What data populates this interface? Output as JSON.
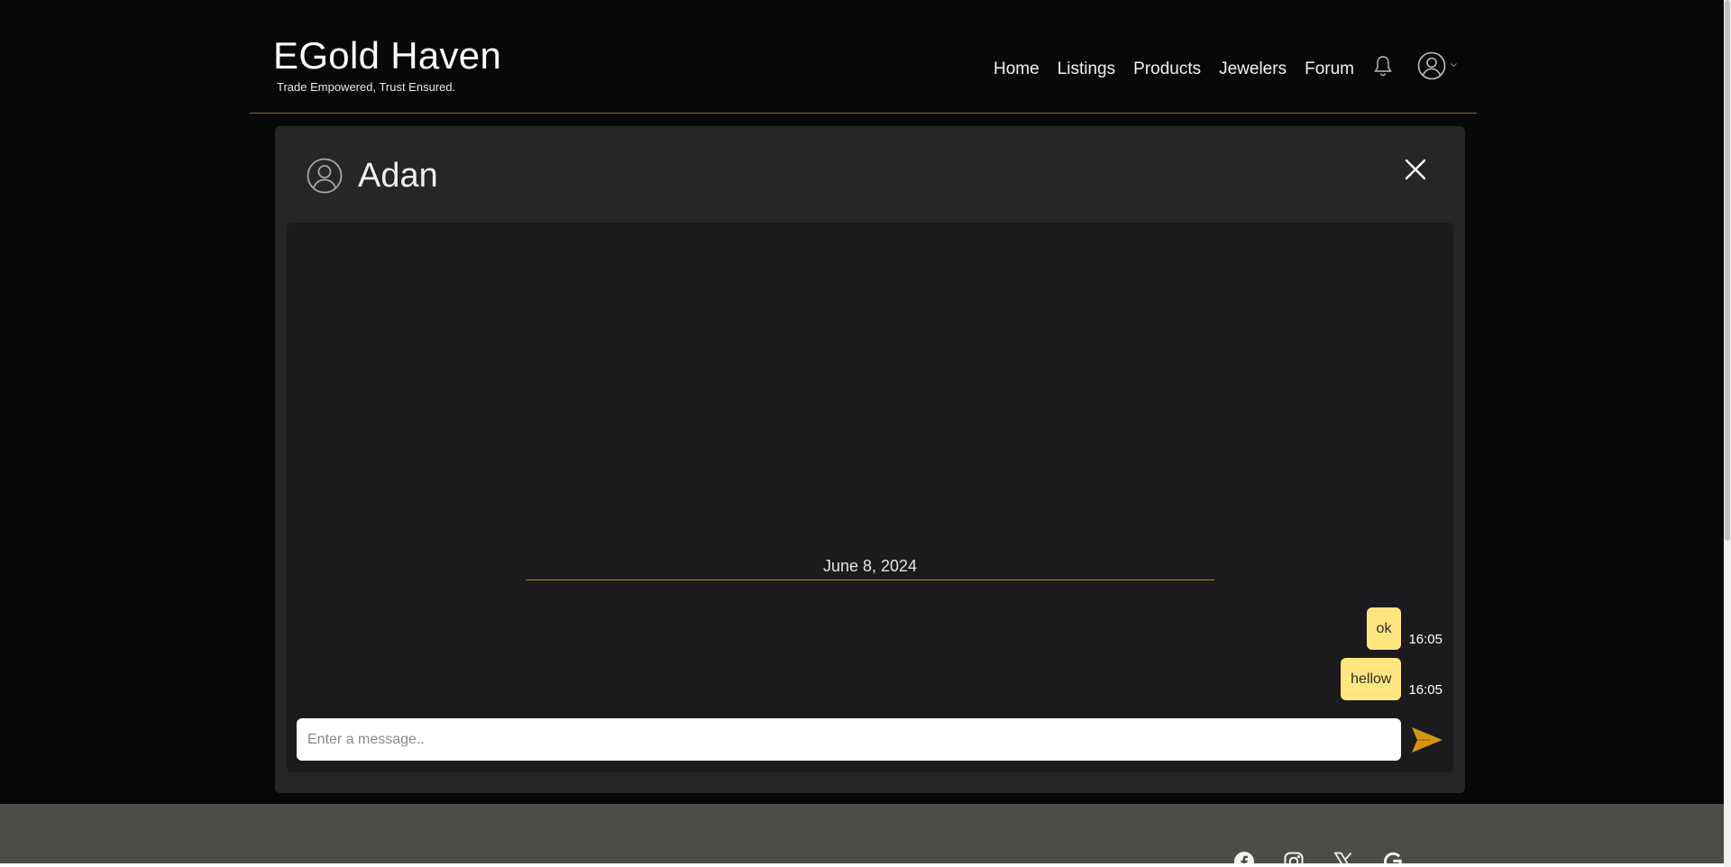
{
  "header": {
    "brand_title": "EGold Haven",
    "brand_tagline": "Trade Empowered, Trust Ensured.",
    "nav": [
      "Home",
      "Listings",
      "Products",
      "Jewelers",
      "Forum"
    ],
    "icons": [
      "bell-icon",
      "account-icon",
      "chevron-down-icon"
    ]
  },
  "chat": {
    "user_name": "Adan",
    "date_label": "June 8, 2024",
    "messages": [
      {
        "text": "ok",
        "time": "16:05"
      },
      {
        "text": "hellow",
        "time": "16:05"
      }
    ],
    "input_placeholder": "Enter a message..",
    "icons": [
      "user-circle-icon",
      "close-icon",
      "send-icon"
    ]
  },
  "footer": {
    "social_icons": [
      "facebook-icon",
      "instagram-icon",
      "x-icon",
      "google-icon"
    ]
  },
  "colors": {
    "accent_gold": "#d4960f",
    "bubble": "#ffe680",
    "panel": "#262628",
    "chat_body": "#1b1b1d",
    "divider": "#b8892b",
    "footer": "#4b4d49"
  }
}
